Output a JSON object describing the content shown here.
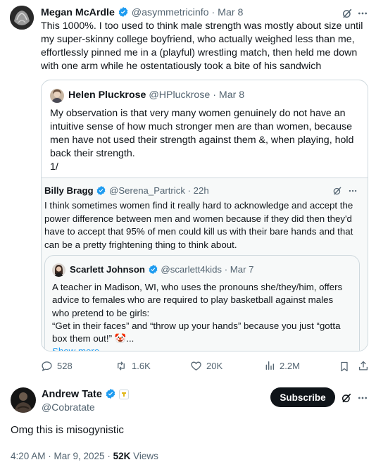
{
  "main_tweet": {
    "author_name": "Megan McArdle",
    "handle": "@asymmetricinfo",
    "date": "· Mar 8",
    "text_lines": [
      "This 1000%. I too used to think male strength was mostly about size until",
      "my super-skinny college boyfriend, who actually weighed less than me,",
      "effortlessly pinned me in a (playful) wrestling match, then held me down",
      "with one arm while he ostentatiously took a bite of his sandwich"
    ],
    "quote": {
      "author_name": "Helen Pluckrose",
      "handle": "@HPluckrose",
      "date": "· Mar 8",
      "text_lines": [
        "My observation is that very many women genuinely do not have an",
        "intuitive sense of how much stronger men are than women, because",
        "men have not used their strength against them &, when playing, hold",
        "back their strength.",
        "1/"
      ],
      "reply": {
        "author_name": "Billy Bragg",
        "handle": "@Serena_Partrick",
        "date": "· 22h",
        "text_lines": [
          "I think sometimes women find it really hard to acknowledge and accept the",
          "power difference between men and women because if they did then they'd",
          "have to accept that 95% of men could kill us with their bare hands and that",
          "can be a pretty frightening thing to think about."
        ],
        "inner_quote": {
          "author_name": "Scarlett Johnson",
          "handle": "@scarlett4kids",
          "date": "· Mar 7",
          "text_lines": [
            "A teacher in Madison, WI, who uses the pronouns she/they/him, offers",
            "advice to females who are required to play basketball against males",
            "who pretend to be girls:",
            "“Get in their faces” and “throw up your hands” because you just “gotta",
            "box them out!” 🤡..."
          ],
          "show_more": "Show more"
        }
      }
    },
    "stats": {
      "replies": "528",
      "reposts": "1.6K",
      "likes": "20K",
      "views": "2.2M"
    }
  },
  "reply_tweet": {
    "author_name": "Andrew Tate",
    "handle": "@Cobratate",
    "subscribe_label": "Subscribe",
    "text": "Omg this is misogynistic",
    "timestamp": "4:20 AM · Mar 9, 2025 · ",
    "views_count": "52K",
    "views_label": " Views"
  },
  "colors": {
    "verified_blue": "#1d9bf0",
    "gold_badge": "#e2b719",
    "link_blue": "#1d9bf0",
    "muted": "#536471",
    "border": "#cfd9de"
  }
}
